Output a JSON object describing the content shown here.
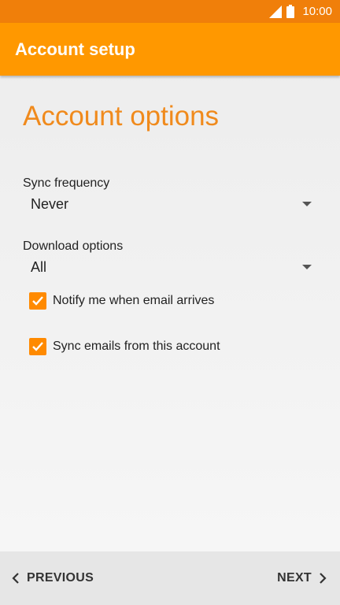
{
  "status_bar": {
    "time": "10:00",
    "icons": [
      "signal-icon",
      "battery-icon"
    ]
  },
  "app_bar": {
    "title": "Account setup",
    "color": "#ff9800"
  },
  "page": {
    "title": "Account options",
    "accent": "#f08a1c"
  },
  "sync_frequency": {
    "label": "Sync frequency",
    "value": "Never"
  },
  "download_options": {
    "label": "Download options",
    "value": "All"
  },
  "checkboxes": [
    {
      "label": "Notify me when email arrives",
      "checked": true
    },
    {
      "label": "Sync emails from this account",
      "checked": true
    }
  ],
  "nav": {
    "previous": "PREVIOUS",
    "next": "NEXT"
  }
}
